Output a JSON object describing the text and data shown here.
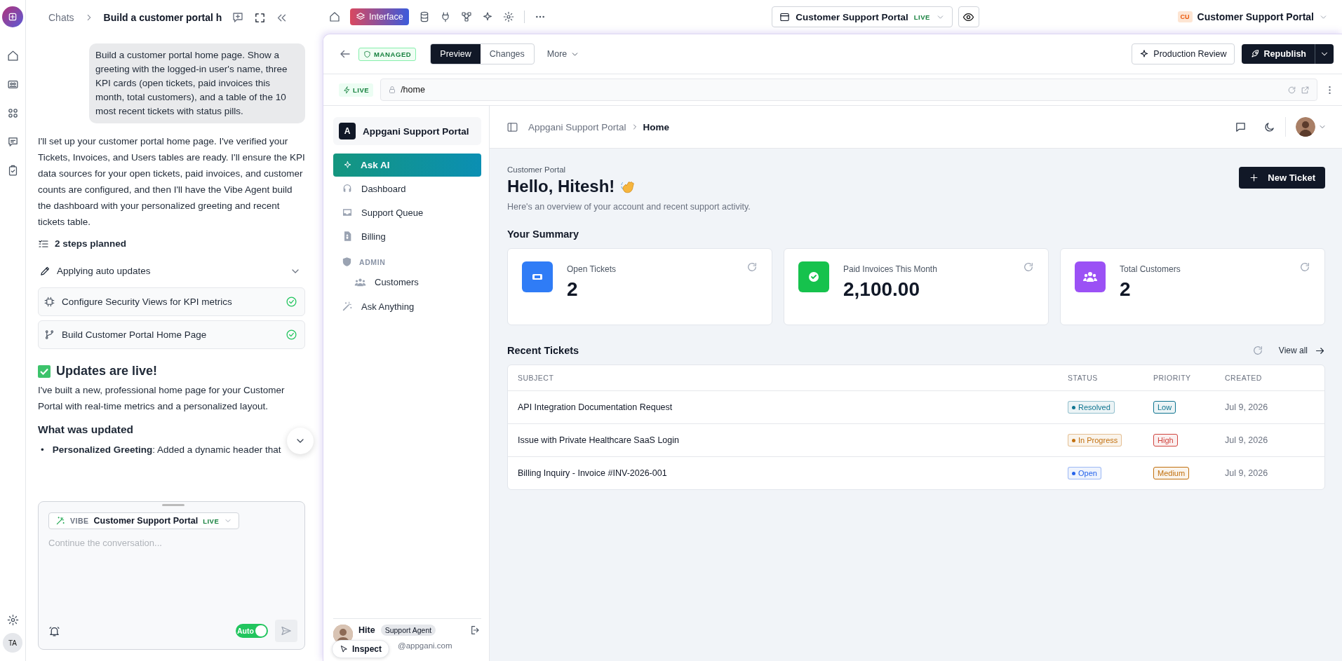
{
  "rail": {
    "avatar": "TA"
  },
  "chat": {
    "breadcrumb": "Chats",
    "title": "Build a customer portal h",
    "user_message": "Build a customer portal home page. Show a greeting with the logged-in user's name, three KPI cards (open tickets, paid invoices this month, total customers), and a table of the 10 most recent tickets with status pills.",
    "reply": "I'll set up your customer portal home page. I've verified your Tickets, Invoices, and Users tables are ready. I'll ensure the KPI data sources for your open tickets, paid invoices, and customer counts are configured, and then I'll have the Vibe Agent build the dashboard with your personalized greeting and recent tickets table.",
    "plan": {
      "title": "2 steps planned",
      "status": "Applying auto updates",
      "expanded": true,
      "steps": [
        {
          "label": "Configure Security Views for KPI metrics",
          "done": true
        },
        {
          "label": "Build Customer Portal Home Page",
          "done": true
        }
      ]
    },
    "updates_heading": "Updates are live!",
    "updates_text": "I've built a new, professional home page for your Customer Portal with real-time metrics and a personalized layout.",
    "section_heading": "What was updated",
    "bullets": [
      {
        "marker": "•",
        "text": "**Personalized Greeting**: Added a dynamic header that"
      }
    ],
    "composer": {
      "mode": "VIBE",
      "app": "Customer Support Portal",
      "badge": "LIVE",
      "placeholder": "Continue the conversation...",
      "auto_label": "Auto",
      "auto_on": true
    }
  },
  "topbar": {
    "active_tool": "Interface",
    "app": {
      "name": "Customer Support Portal",
      "badge": "LIVE"
    },
    "workspace": {
      "initials": "CU",
      "name": "Customer Support Portal"
    }
  },
  "preview": {
    "managed": "MANAGED",
    "tabs": [
      {
        "label": "Preview",
        "selected": true
      },
      {
        "label": "Changes",
        "selected": false
      }
    ],
    "more": "More",
    "review_button": "Production Review",
    "publish_button": "Republish",
    "live": "LIVE",
    "url": "/home",
    "inspect": "Inspect"
  },
  "portal": {
    "brand_initial": "A",
    "brand": "Appgani Support Portal",
    "ask_ai": "Ask AI",
    "nav": [
      {
        "kind": "link",
        "label": "Dashboard"
      },
      {
        "kind": "link",
        "label": "Support Queue"
      },
      {
        "kind": "link",
        "label": "Billing"
      },
      {
        "kind": "section",
        "label": "ADMIN",
        "children": [
          {
            "kind": "link",
            "label": "Customers"
          }
        ]
      },
      {
        "kind": "link",
        "label": "Ask Anything"
      }
    ],
    "user": {
      "name": "Hite",
      "role": "Support Agent",
      "email": "@appgani.com"
    },
    "breadcrumb": [
      "Appgani Support Portal",
      "Home"
    ],
    "eyebrow": "Customer Portal",
    "greeting": "Hello, Hitesh!",
    "subtitle": "Here's an overview of your account and recent support activity.",
    "new_ticket": "New Ticket",
    "summary_title": "Your Summary",
    "kpis": [
      {
        "label": "Open Tickets",
        "value": "2",
        "color": "#2f7cf6"
      },
      {
        "label": "Paid Invoices This Month",
        "value": "2,100.00",
        "color": "#16c24d"
      },
      {
        "label": "Total Customers",
        "value": "2",
        "color": "#9b51f5"
      }
    ],
    "recent_title": "Recent Tickets",
    "view_all": "View all",
    "columns": [
      "SUBJECT",
      "STATUS",
      "PRIORITY",
      "CREATED"
    ],
    "rows": [
      {
        "subject": "API Integration Documentation Request",
        "status": {
          "label": "Resolved",
          "color": "#0e7490"
        },
        "priority": {
          "label": "Low",
          "color": "#0e7490"
        },
        "created": "Jul 9, 2026"
      },
      {
        "subject": "Issue with Private Healthcare SaaS Login",
        "status": {
          "label": "In Progress",
          "color": "#c2700e"
        },
        "priority": {
          "label": "High",
          "color": "#d0443e"
        },
        "created": "Jul 9, 2026"
      },
      {
        "subject": "Billing Inquiry - Invoice #INV-2026-001",
        "status": {
          "label": "Open",
          "color": "#2563eb"
        },
        "priority": {
          "label": "Medium",
          "color": "#c2700e"
        },
        "created": "Jul 9, 2026"
      }
    ]
  }
}
